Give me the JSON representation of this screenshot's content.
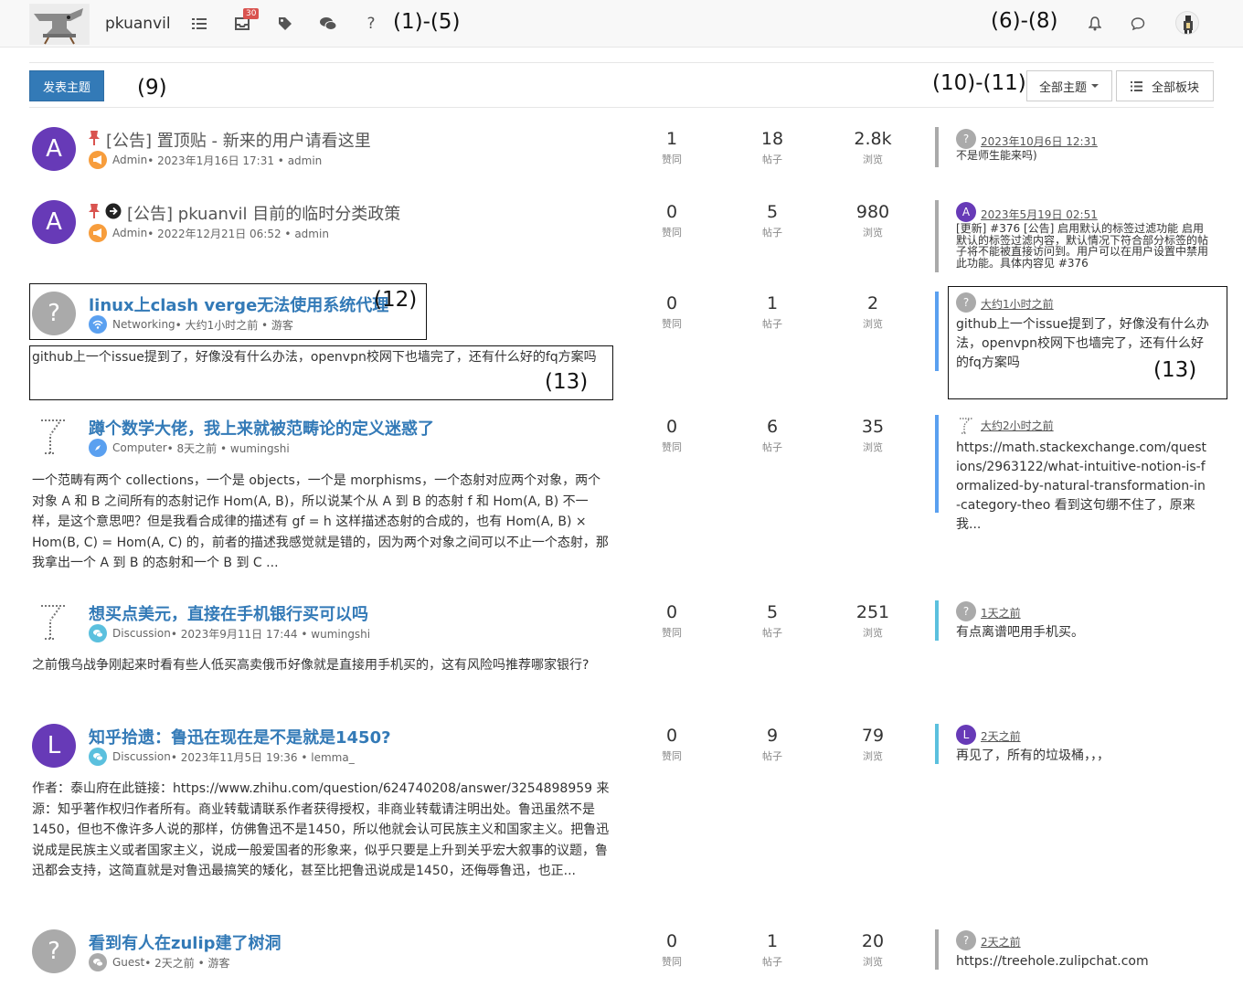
{
  "header": {
    "brand": "pkuanvil",
    "annotation_left": "(1)-(5)",
    "annotation_right": "(6)-(8)",
    "unread_badge": "30",
    "icons": [
      "list-icon",
      "inbox-icon",
      "tags-icon",
      "comments-icon",
      "help-icon",
      "bell-icon",
      "chat-icon"
    ],
    "help_glyph": "?"
  },
  "toolbar": {
    "new_topic_label": "发表主题",
    "annotation_new": "(9)",
    "annotation_filters": "(10)-(11)",
    "all_topics_label": "全部主题",
    "all_categories_label": "全部板块"
  },
  "stat_labels": {
    "votes": "赞同",
    "posts": "帖子",
    "views": "浏览"
  },
  "topics": [
    {
      "avatar": "A",
      "avatar_color": "#673ab7",
      "title": "[公告] 置顶贴 - 新来的用户请看这里",
      "category": "Admin",
      "category_color": "#f79d3c",
      "meta": " • 2023年1月16日 17:31 • admin",
      "votes": "1",
      "posts": "18",
      "views": "2.8k",
      "last_avatar": "?",
      "last_avatar_color": "#aaaaaa",
      "last_time": "2023年10月6日 12:31",
      "last_text": "不是师生能来吗)",
      "bar_color": "#aaaaaa"
    },
    {
      "avatar": "A",
      "avatar_color": "#673ab7",
      "title": "[公告] pkuanvil 目前的临时分类政策",
      "category": "Admin",
      "category_color": "#f79d3c",
      "meta": " • 2022年12月21日 06:52 • admin",
      "votes": "0",
      "posts": "5",
      "views": "980",
      "last_avatar": "A",
      "last_avatar_color": "#673ab7",
      "last_time": "2023年5月19日 02:51",
      "last_text": "[更新] #376 [公告] 启用默认的标签过滤功能 启用默认的标签过滤内容，默认情况下符合部分标签的帖子将不能被直接访问到。用户可以在用户设置中禁用此功能。具体内容见 #376",
      "bar_color": "#aaaaaa"
    },
    {
      "avatar": "?",
      "avatar_color": "#aaaaaa",
      "title": "linux上clash verge无法使用系统代理",
      "annotation": "(12)",
      "category": "Networking",
      "category_color": "#5aa0f0",
      "meta": " • 大约1小时之前 • 游客",
      "teaser": "github上一个issue提到了，好像没有什么办法，openvpn校网下也墙完了，还有什么好的fq方案吗",
      "teaser_annotation": "(13)",
      "votes": "0",
      "posts": "1",
      "views": "2",
      "last_avatar": "?",
      "last_avatar_color": "#aaaaaa",
      "last_time": "大约1小时之前",
      "last_text": "github上一个issue提到了，好像没有什么办法，openvpn校网下也墙完了，还有什么好的fq方案吗",
      "last_annotation": "(13)",
      "bar_color": "#5aa0f0"
    },
    {
      "avatar": "wumingshi",
      "avatar_color": "#ffffff",
      "title": "蹲个数学大佬，我上来就被范畴论的定义迷惑了",
      "category": "Computer",
      "category_color": "#5aa0f0",
      "meta": " • 8天之前 • wumingshi",
      "teaser": "一个范畴有两个 collections，一个是 objects，一个是 morphisms，一个态射对应两个对象，两个对象 A 和 B 之间所有的态射记作 Hom(A, B)，所以说某个从 A 到 B 的态射 f 和 Hom(A, B) 不一样，是这个意思吧？但是我看合成律的描述有 gf = h 这样描述态射的合成的，也有 Hom(A, B) × Hom(B, C) = Hom(A, C) 的，前者的描述我感觉就是错的，因为两个对象之间可以不止一个态射，那我拿出一个 A 到 B 的态射和一个 B 到 C ...",
      "votes": "0",
      "posts": "6",
      "views": "35",
      "last_time": "大约2小时之前",
      "last_text": "https://math.stackexchange.com/questions/2963122/what-intuitive-notion-is-formalized-by-natural-transformation-in-category-theo 看到这句绷不住了，原来我...",
      "bar_color": "#5aa0f0"
    },
    {
      "avatar": "wumingshi",
      "avatar_color": "#ffffff",
      "title": "想买点美元，直接在手机银行买可以吗",
      "category": "Discussion",
      "category_color": "#5bc0de",
      "meta": " • 2023年9月11日 17:44 • wumingshi",
      "teaser": "之前俄乌战争刚起来时看有些人低买高卖俄币好像就是直接用手机买的，这有风险吗推荐哪家银行?",
      "votes": "0",
      "posts": "5",
      "views": "251",
      "last_avatar": "?",
      "last_avatar_color": "#aaaaaa",
      "last_time": "1天之前",
      "last_text": "有点离谱吧用手机买。",
      "bar_color": "#5bc0de"
    },
    {
      "avatar": "L",
      "avatar_color": "#673ab7",
      "title": "知乎拾遗：鲁迅在现在是不是就是1450?",
      "category": "Discussion",
      "category_color": "#5bc0de",
      "meta": " • 2023年11月5日 19:36 • lemma_",
      "teaser": "作者：泰山府在此链接：https://www.zhihu.com/question/624740208/answer/3254898959 来源：知乎著作权归作者所有。商业转载请联系作者获得授权，非商业转载请注明出处。鲁迅虽然不是1450，但也不像许多人说的那样，仿佛鲁迅不是1450，所以他就会认可民族主义和国家主义。把鲁迅说成是民族主义或者国家主义，说成一般爱国者的形象来，似乎只要是上升到关乎宏大叙事的议题，鲁迅都会支持，这简直就是对鲁迅最搞笑的矮化，甚至比把鲁迅说成是1450，还侮辱鲁迅，也正...",
      "votes": "0",
      "posts": "9",
      "views": "79",
      "last_avatar": "L",
      "last_avatar_color": "#673ab7",
      "last_time": "2天之前",
      "last_text": "再见了，所有的垃圾桶，，，",
      "bar_color": "#5bc0de"
    },
    {
      "avatar": "?",
      "avatar_color": "#aaaaaa",
      "title": "看到有人在zulip建了树洞",
      "category": "Guest",
      "category_color": "#aaaaaa",
      "meta": " • 2天之前 • 游客",
      "votes": "0",
      "posts": "1",
      "views": "20",
      "last_avatar": "?",
      "last_avatar_color": "#aaaaaa",
      "last_time": "2天之前",
      "last_text": "https://treehole.zulipchat.com",
      "bar_color": "#aaaaaa"
    }
  ]
}
